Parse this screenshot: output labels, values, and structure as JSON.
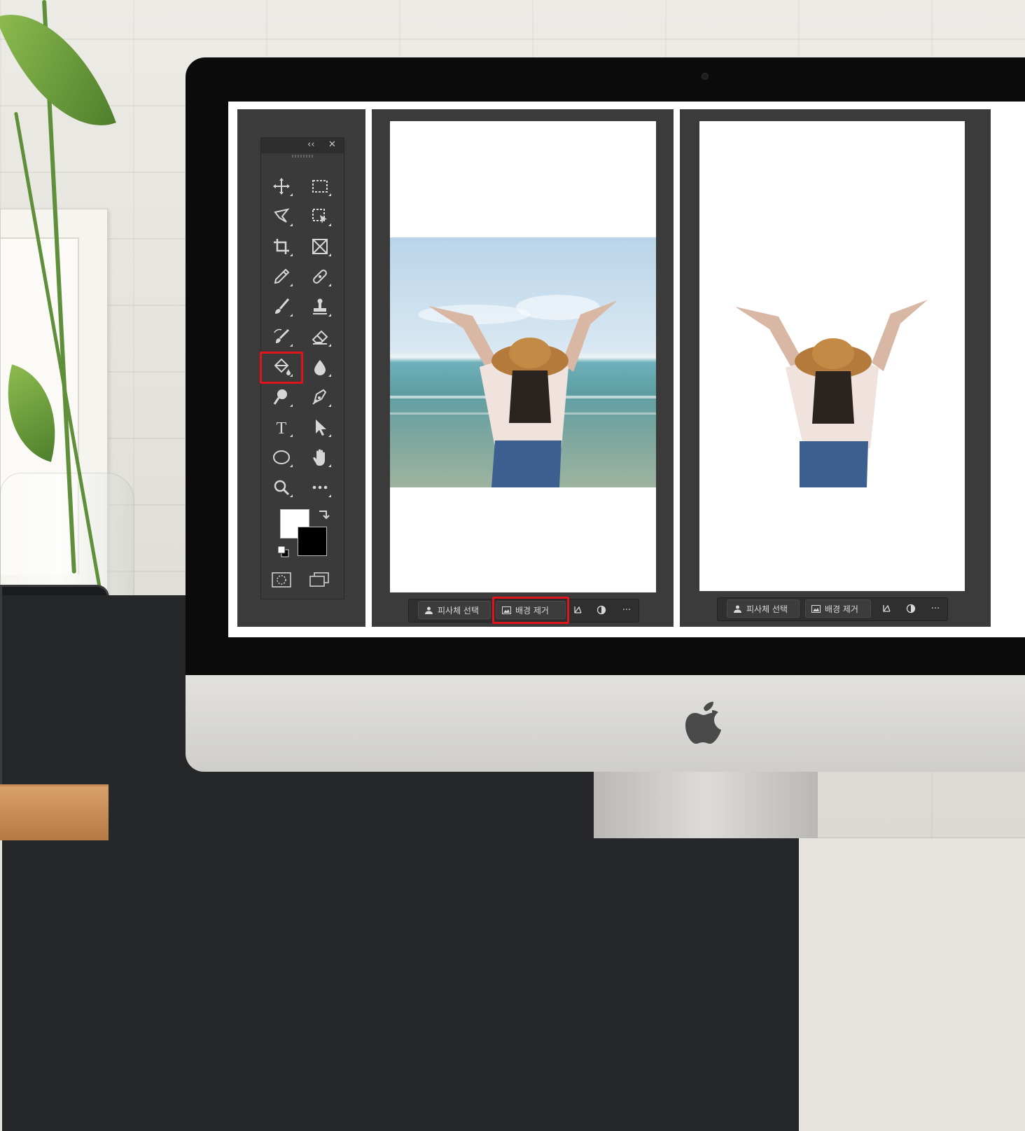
{
  "colors": {
    "highlight": "#e0141a",
    "panel_bg": "#3b3b3b",
    "toolbox_bg": "#3a3a3a",
    "foreground_swatch": "#ffffff",
    "background_swatch": "#000000"
  },
  "toolbox": {
    "collapse_glyph": "‹‹",
    "close_glyph": "✕",
    "tools": [
      {
        "name": "move-icon",
        "glyph": "✥"
      },
      {
        "name": "rectangular-marquee-icon",
        "glyph": "⬚"
      },
      {
        "name": "lasso-icon",
        "glyph": "lasso"
      },
      {
        "name": "object-selection-icon",
        "glyph": "obj-select"
      },
      {
        "name": "crop-icon",
        "glyph": "crop"
      },
      {
        "name": "frame-icon",
        "glyph": "frame"
      },
      {
        "name": "eyedropper-icon",
        "glyph": "eyedropper"
      },
      {
        "name": "spot-healing-icon",
        "glyph": "bandage"
      },
      {
        "name": "brush-icon",
        "glyph": "brush"
      },
      {
        "name": "clone-stamp-icon",
        "glyph": "stamp"
      },
      {
        "name": "history-brush-icon",
        "glyph": "history-brush"
      },
      {
        "name": "eraser-icon",
        "glyph": "eraser"
      },
      {
        "name": "paint-bucket-icon",
        "glyph": "bucket",
        "highlighted": true
      },
      {
        "name": "blur-icon",
        "glyph": "drop"
      },
      {
        "name": "dodge-icon",
        "glyph": "dodge"
      },
      {
        "name": "pen-icon",
        "glyph": "pen"
      },
      {
        "name": "type-icon",
        "glyph": "T"
      },
      {
        "name": "path-selection-icon",
        "glyph": "arrow"
      },
      {
        "name": "ellipse-icon",
        "glyph": "ellipse"
      },
      {
        "name": "hand-icon",
        "glyph": "hand"
      },
      {
        "name": "zoom-icon",
        "glyph": "zoom"
      },
      {
        "name": "more-tools-icon",
        "glyph": "•••"
      }
    ]
  },
  "contextual_bar_left": {
    "select_subject_label": "피사체 선택",
    "remove_background_label": "배경 제거",
    "remove_background_highlighted": true,
    "more_label": "···"
  },
  "contextual_bar_right": {
    "select_subject_label": "피사체 선택",
    "remove_background_label": "배경 제거",
    "more_label": "···"
  }
}
